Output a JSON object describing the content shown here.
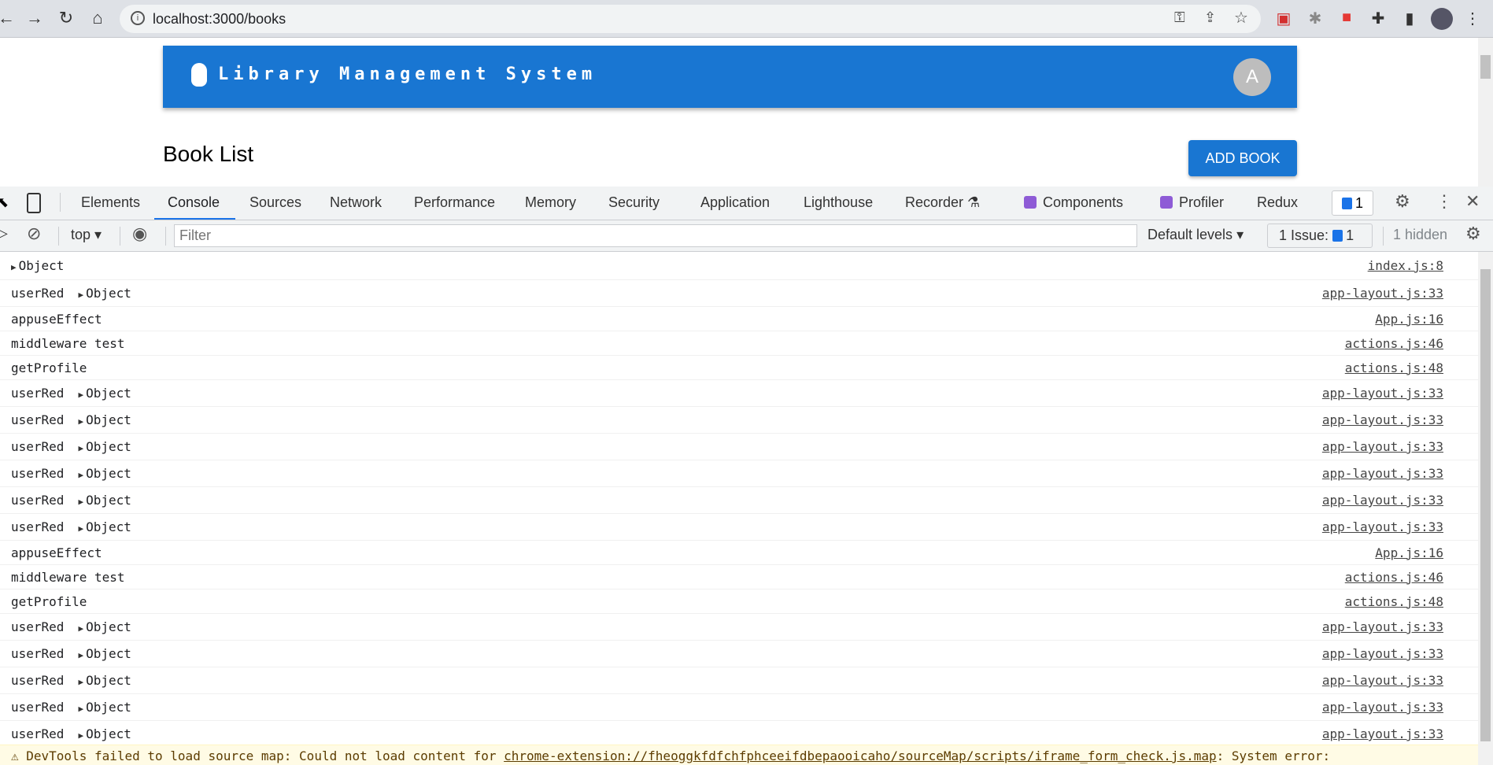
{
  "browser": {
    "url": "localhost:3000/books"
  },
  "app": {
    "title": "Library Management System",
    "avatar_letter": "A",
    "page_title": "Book List",
    "add_button": "ADD BOOK"
  },
  "devtools": {
    "tabs": [
      "Elements",
      "Console",
      "Sources",
      "Network",
      "Performance",
      "Memory",
      "Security",
      "Application",
      "Lighthouse",
      "Recorder",
      "Components",
      "Profiler",
      "Redux"
    ],
    "active_tab": "Console",
    "issue_badge_count": "1",
    "context": "top",
    "filter_placeholder": "Filter",
    "levels": "Default levels",
    "issues_label": "1 Issue:",
    "issues_count": "1",
    "hidden": "1 hidden"
  },
  "console": [
    {
      "label": "",
      "obj": "Object",
      "src": "index.js:8"
    },
    {
      "label": "userRed",
      "obj": "Object",
      "src": "app-layout.js:33"
    },
    {
      "label": "appuseEffect",
      "obj": "",
      "src": "App.js:16"
    },
    {
      "label": "middleware test",
      "obj": "",
      "src": "actions.js:46"
    },
    {
      "label": "getProfile",
      "obj": "",
      "src": "actions.js:48"
    },
    {
      "label": "userRed",
      "obj": "Object",
      "src": "app-layout.js:33"
    },
    {
      "label": "userRed",
      "obj": "Object",
      "src": "app-layout.js:33"
    },
    {
      "label": "userRed",
      "obj": "Object",
      "src": "app-layout.js:33"
    },
    {
      "label": "userRed",
      "obj": "Object",
      "src": "app-layout.js:33"
    },
    {
      "label": "userRed",
      "obj": "Object",
      "src": "app-layout.js:33"
    },
    {
      "label": "userRed",
      "obj": "Object",
      "src": "app-layout.js:33"
    },
    {
      "label": "appuseEffect",
      "obj": "",
      "src": "App.js:16"
    },
    {
      "label": "middleware test",
      "obj": "",
      "src": "actions.js:46"
    },
    {
      "label": "getProfile",
      "obj": "",
      "src": "actions.js:48"
    },
    {
      "label": "userRed",
      "obj": "Object",
      "src": "app-layout.js:33"
    },
    {
      "label": "userRed",
      "obj": "Object",
      "src": "app-layout.js:33"
    },
    {
      "label": "userRed",
      "obj": "Object",
      "src": "app-layout.js:33"
    },
    {
      "label": "userRed",
      "obj": "Object",
      "src": "app-layout.js:33"
    },
    {
      "label": "userRed",
      "obj": "Object",
      "src": "app-layout.js:33"
    }
  ],
  "warning": {
    "prefix": "DevTools failed to load source map: Could not load content for ",
    "link": "chrome-extension://fheoggkfdfchfphceeifdbepaooicaho/sourceMap/scripts/iframe_form_check.js.map",
    "suffix": ": System error:"
  }
}
